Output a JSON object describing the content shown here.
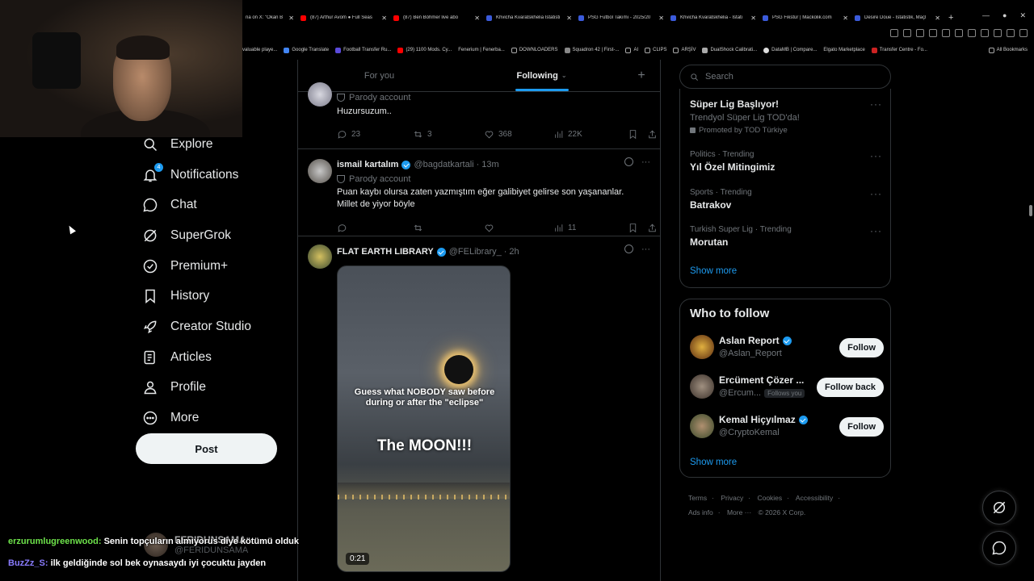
{
  "browser": {
    "tabs": [
      {
        "label": "na on X: \"Okan B",
        "color": "#000000"
      },
      {
        "label": "(87) Arthur Avom ● Full Seas",
        "color": "#ff0000"
      },
      {
        "label": "(87) Ben Böhmer live abo",
        "color": "#ff0000"
      },
      {
        "label": "Khvicha Kvaratskhelia İstatisti",
        "color": "#3b5bdb"
      },
      {
        "label": "PSG Futbol Takımı - 2025/20",
        "color": "#3b5bdb"
      },
      {
        "label": "Khvicha Kvaratskhelia - İstati",
        "color": "#3b5bdb"
      },
      {
        "label": "PSG Fikstür | Mackolik.com",
        "color": "#3b5bdb"
      },
      {
        "label": "Desire Doue - İstatistik, Maçl",
        "color": "#3b5bdb"
      }
    ],
    "tab_close": "✕",
    "new_tab": "+",
    "bookmarks": [
      "valuable playe...",
      "Google Translate",
      "Football Transfer Ru...",
      "(29) 1100 Mods. Cy...",
      "Fenerium | Fenerba...",
      "DOWNLOADERS",
      "Squadron 42 | First-...",
      "AI",
      "CLIPS",
      "ARŞİV",
      "DualShock Calibrati...",
      "DataMB | Compare...",
      "Elgato Marketplace",
      "Transfer Centre - Fo..."
    ],
    "all_bookmarks": "All Bookmarks"
  },
  "nav": {
    "items": [
      {
        "label": "Explore",
        "icon": "search-icon"
      },
      {
        "label": "Notifications",
        "icon": "bell-icon",
        "badge": "4"
      },
      {
        "label": "Chat",
        "icon": "chat-icon"
      },
      {
        "label": "SuperGrok",
        "icon": "grok-icon"
      },
      {
        "label": "Premium+",
        "icon": "verified-icon"
      },
      {
        "label": "History",
        "icon": "bookmark-icon"
      },
      {
        "label": "Creator Studio",
        "icon": "rocket-icon"
      },
      {
        "label": "Articles",
        "icon": "article-icon"
      },
      {
        "label": "Profile",
        "icon": "person-icon"
      },
      {
        "label": "More",
        "icon": "more-icon"
      }
    ],
    "post_label": "Post"
  },
  "feed": {
    "tabs": {
      "for_you": "For you",
      "following": "Following"
    },
    "tweet0": {
      "parody": "Parody account",
      "text": "Huzursuzum..",
      "replies": "23",
      "retweets": "3",
      "likes": "368",
      "views": "22K"
    },
    "tweet1": {
      "name": "ismail kartalım",
      "handle": "@bagdatkartali",
      "time": "13m",
      "parody": "Parody account",
      "text": "Puan kaybı olursa zaten yazmıştım eğer galibiyet gelirse son yaşananlar.\nMillet de yiyor böyle",
      "views": "11"
    },
    "tweet2": {
      "name": "FLAT EARTH LIBRARY",
      "handle": "@FELibrary_",
      "time": "2h",
      "media_caption1": "Guess what NOBODY saw before\nduring or after the \"eclipse\"",
      "media_caption2": "The MOON!!!",
      "duration": "0:21"
    }
  },
  "right": {
    "search_placeholder": "Search",
    "trends": [
      {
        "meta": "",
        "title": "Süper Lig Başlıyor!",
        "sub": "Trendyol Süper Lig TOD'da!",
        "promo": "Promoted by TOD Türkiye"
      },
      {
        "meta": "Politics · Trending",
        "title": "Yıl Özel Mitingimiz"
      },
      {
        "meta": "Sports · Trending",
        "title": "Batrakov"
      },
      {
        "meta": "Turkish Super Lig · Trending",
        "title": "Morutan"
      }
    ],
    "trends_show_more": "Show more",
    "who_title": "Who to follow",
    "who": [
      {
        "name": "Aslan Report",
        "handle": "@Aslan_Report",
        "verified": true,
        "button": "Follow"
      },
      {
        "name": "Ercüment Çözer ...",
        "handle": "@Ercum...",
        "follows_you": "Follows you",
        "verified": false,
        "button": "Follow back"
      },
      {
        "name": "Kemal Hiçyılmaz",
        "handle": "@CryptoKemal",
        "verified": true,
        "button": "Follow"
      }
    ],
    "who_show_more": "Show more",
    "footer": {
      "line1": [
        "Terms",
        "Privacy",
        "Cookies",
        "Accessibility"
      ],
      "line2": [
        "Ads info",
        "More ···",
        "© 2026 X Corp."
      ]
    }
  },
  "chat": {
    "line1_user": "erzurumlugreenwood:",
    "line1_msg": "Senin topçuların almıyorus diye kötümü olduk",
    "line2_user": "BuzZz_S:",
    "line2_msg": "ilk geldiğinde sol bek oynasaydı iyi çocuktu jayden",
    "ghost_name": "FERIDUNSAMA",
    "ghost_handle": "@FERIDUNSAMA"
  }
}
